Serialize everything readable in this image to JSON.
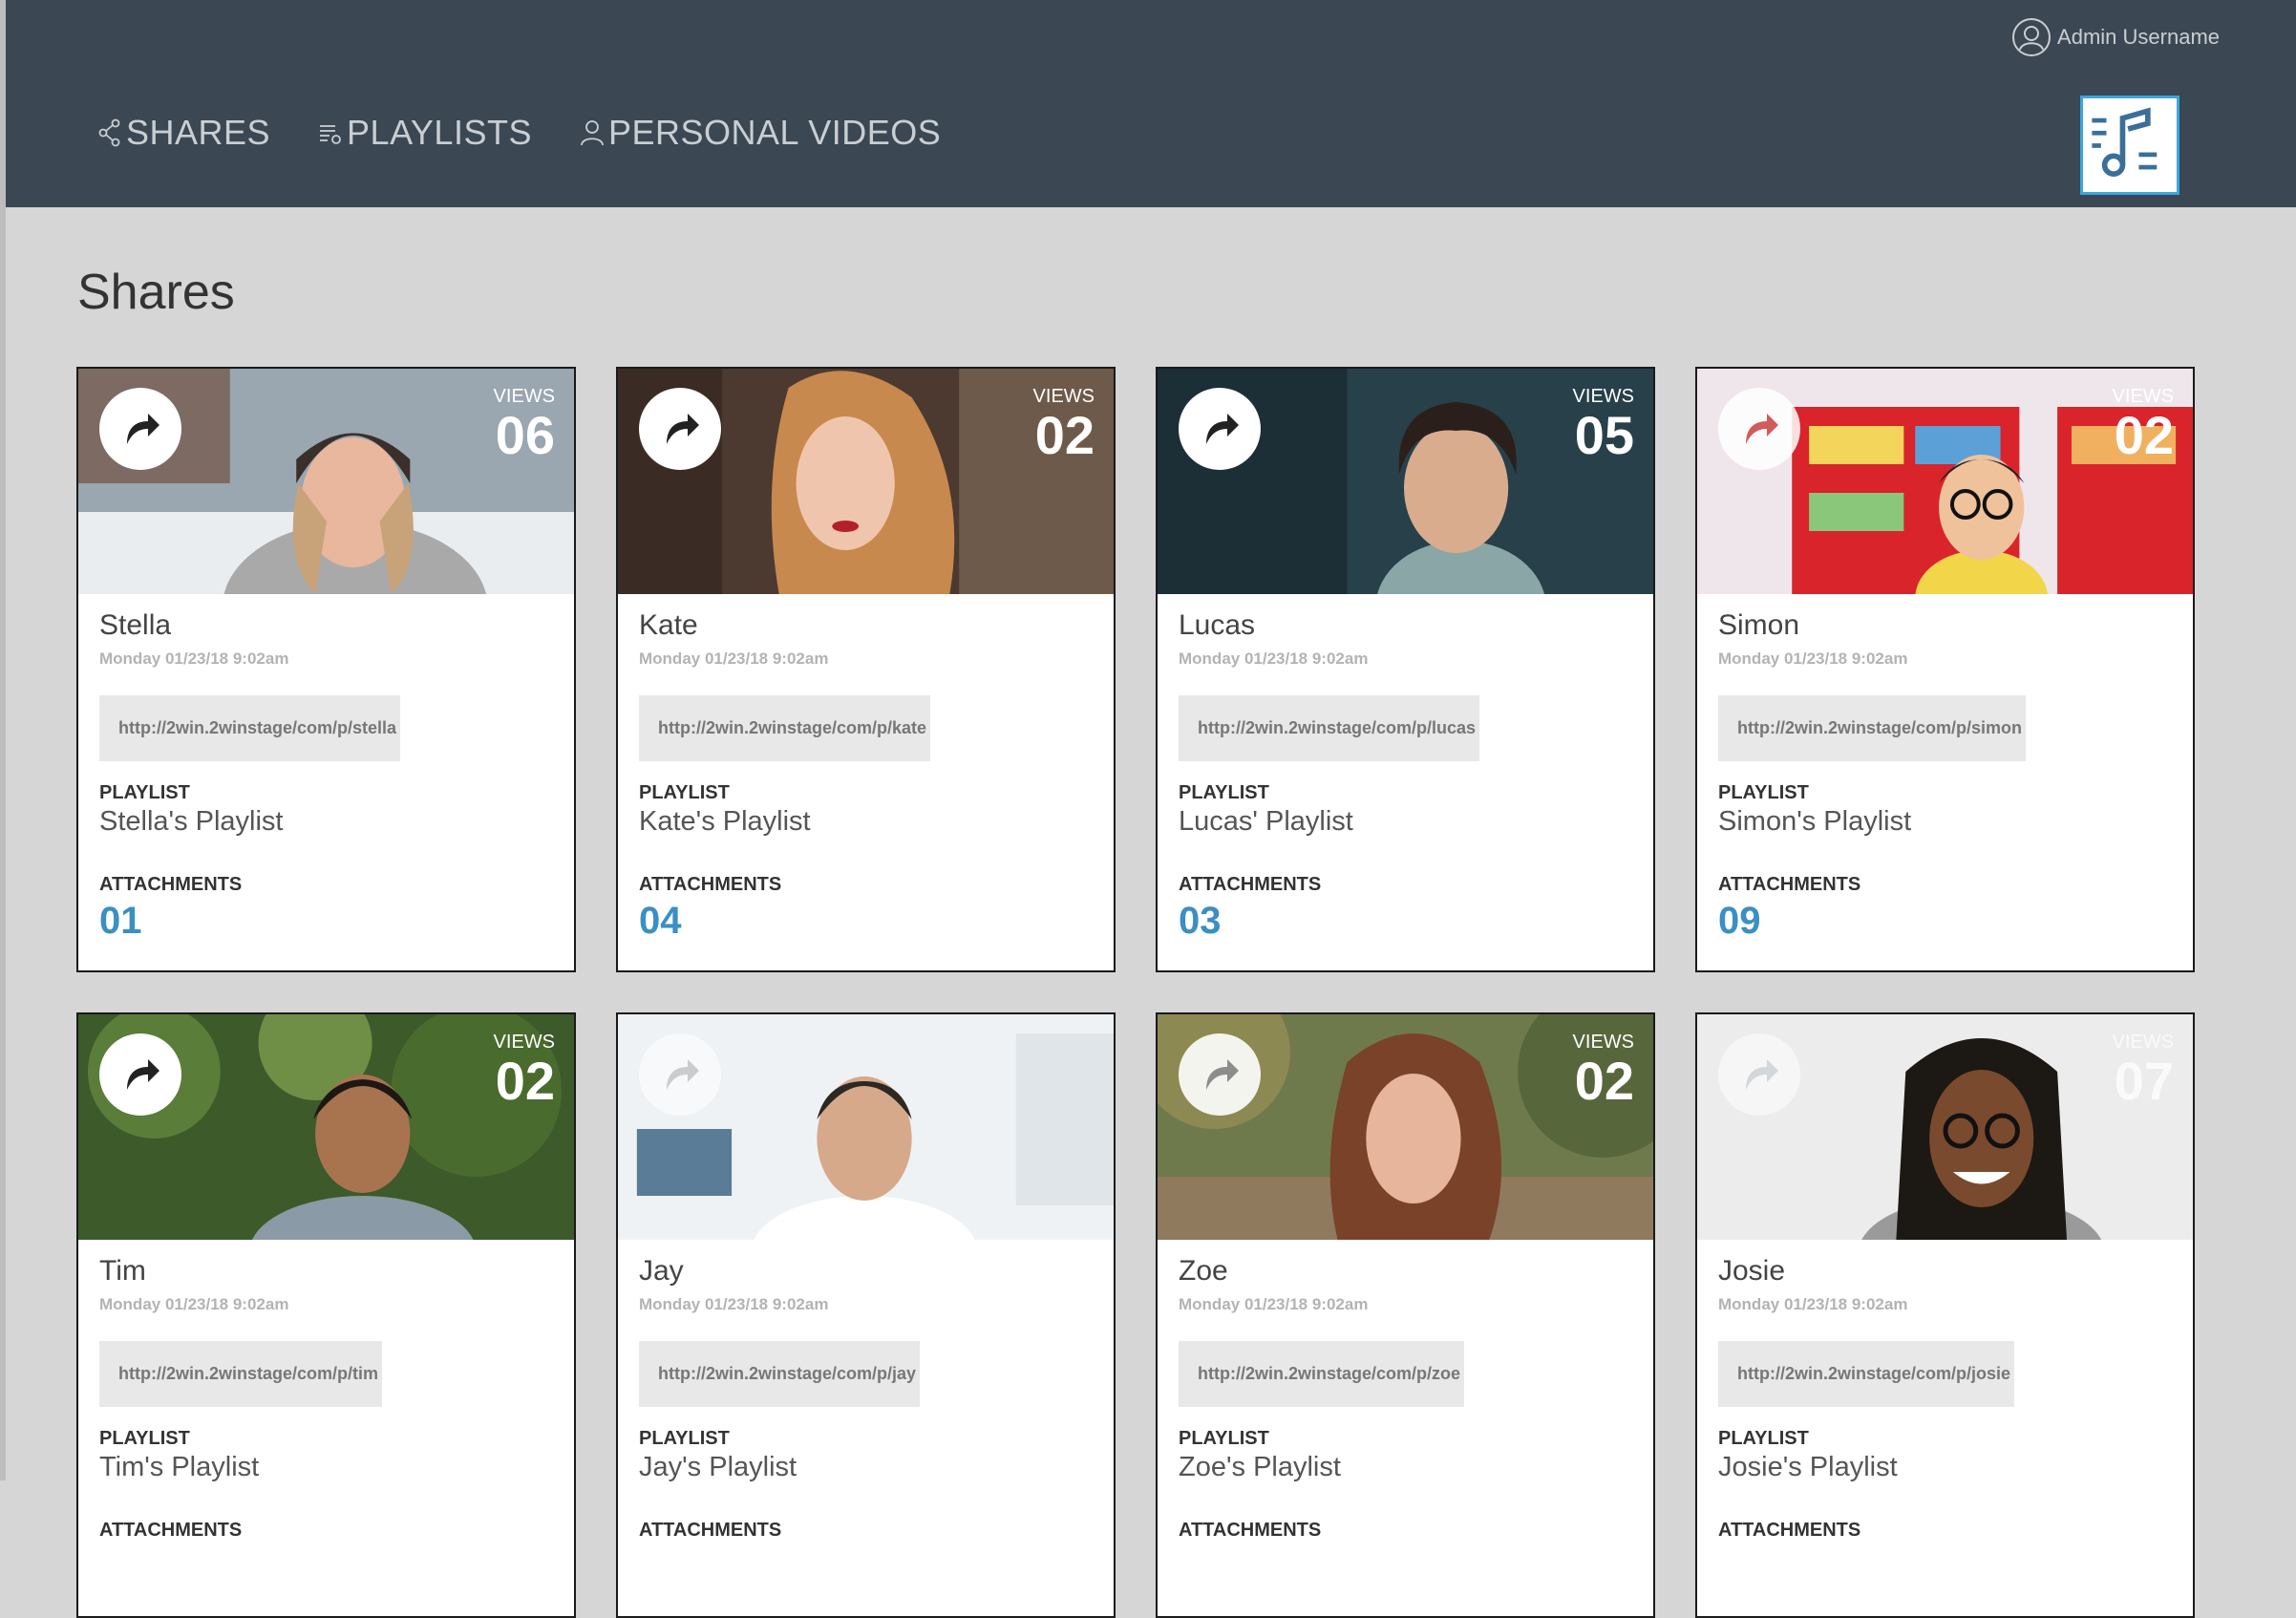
{
  "header": {
    "user_name": "Admin Username",
    "nav": [
      {
        "label": "SHARES"
      },
      {
        "label": "PLAYLISTS"
      },
      {
        "label": "PERSONAL VIDEOS"
      }
    ]
  },
  "page": {
    "title": "Shares"
  },
  "cards": [
    {
      "name": "Stella",
      "date": "Monday 01/23/18 9:02am",
      "link": "http://2win.2winstage/com/p/stella",
      "views_label": "VIEWS",
      "views": "06",
      "playlist_label": "PLAYLIST",
      "playlist": "Stella's Playlist",
      "attachments_label": "ATTACHMENTS",
      "attachments": "01"
    },
    {
      "name": "Kate",
      "date": "Monday 01/23/18 9:02am",
      "link": "http://2win.2winstage/com/p/kate",
      "views_label": "VIEWS",
      "views": "02",
      "playlist_label": "PLAYLIST",
      "playlist": "Kate's Playlist",
      "attachments_label": "ATTACHMENTS",
      "attachments": "04"
    },
    {
      "name": "Lucas",
      "date": "Monday 01/23/18 9:02am",
      "link": "http://2win.2winstage/com/p/lucas",
      "views_label": "VIEWS",
      "views": "05",
      "playlist_label": "PLAYLIST",
      "playlist": "Lucas' Playlist",
      "attachments_label": "ATTACHMENTS",
      "attachments": "03"
    },
    {
      "name": "Simon",
      "date": "Monday 01/23/18 9:02am",
      "link": "http://2win.2winstage/com/p/simon",
      "views_label": "VIEWS",
      "views": "02",
      "playlist_label": "PLAYLIST",
      "playlist": "Simon's Playlist",
      "attachments_label": "ATTACHMENTS",
      "attachments": "09"
    },
    {
      "name": "Tim",
      "date": "Monday 01/23/18 9:02am",
      "link": "http://2win.2winstage/com/p/tim",
      "views_label": "VIEWS",
      "views": "02",
      "playlist_label": "PLAYLIST",
      "playlist": "Tim's Playlist",
      "attachments_label": "ATTACHMENTS",
      "attachments": ""
    },
    {
      "name": "Jay",
      "date": "Monday 01/23/18 9:02am",
      "link": "http://2win.2winstage/com/p/jay",
      "views_label": "",
      "views": "",
      "playlist_label": "PLAYLIST",
      "playlist": "Jay's Playlist",
      "attachments_label": "ATTACHMENTS",
      "attachments": ""
    },
    {
      "name": "Zoe",
      "date": "Monday 01/23/18 9:02am",
      "link": "http://2win.2winstage/com/p/zoe",
      "views_label": "VIEWS",
      "views": "02",
      "playlist_label": "PLAYLIST",
      "playlist": "Zoe's Playlist",
      "attachments_label": "ATTACHMENTS",
      "attachments": ""
    },
    {
      "name": "Josie",
      "date": "Monday 01/23/18 9:02am",
      "link": "http://2win.2winstage/com/p/josie",
      "views_label": "VIEWS",
      "views": "07",
      "playlist_label": "PLAYLIST",
      "playlist": "Josie's Playlist",
      "attachments_label": "ATTACHMENTS",
      "attachments": ""
    }
  ],
  "colors": {
    "header_bg": "#3b4752",
    "page_bg": "#d6d6d6",
    "accent": "#3a8fc5",
    "logo_border": "#3aa6e0"
  },
  "icons": {
    "share": "share-arrow-icon",
    "shares_nav": "share-nodes-icon",
    "playlists_nav": "playlist-icon",
    "personal_videos_nav": "person-icon",
    "user": "user-icon",
    "logo": "music-playlist-logo"
  }
}
